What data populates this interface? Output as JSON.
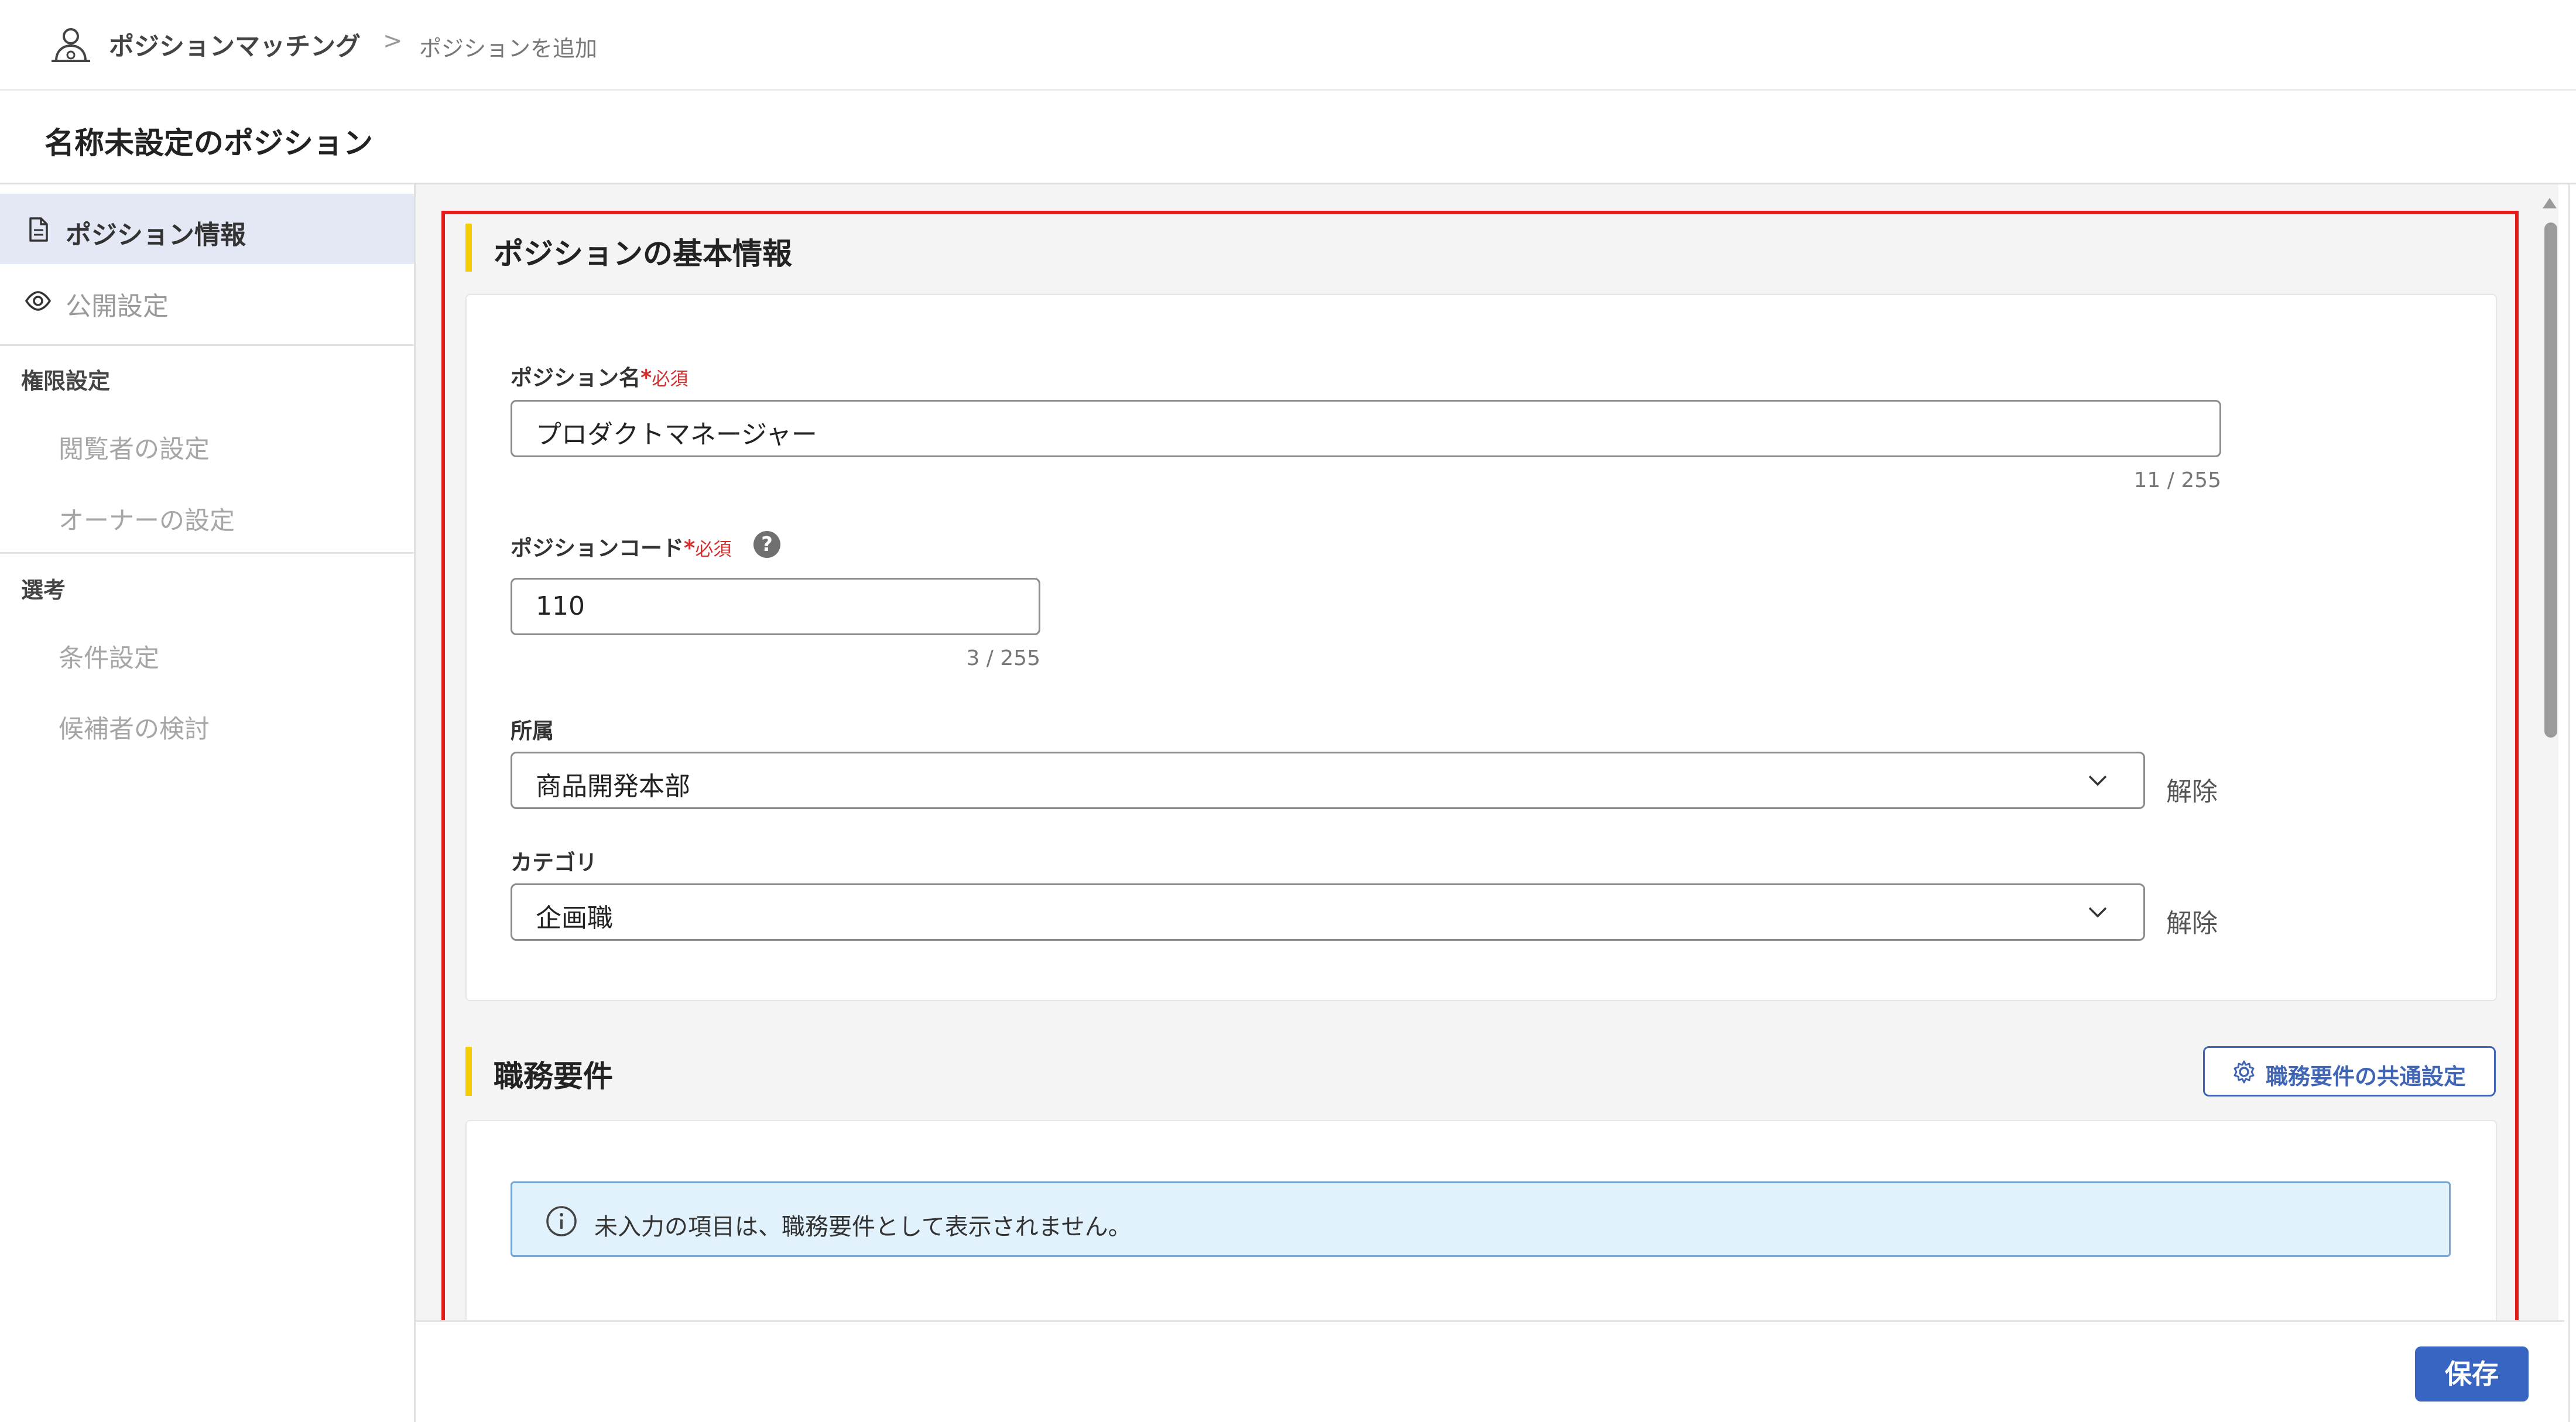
{
  "breadcrumb": {
    "root_label": "ポジションマッチング",
    "separator": ">",
    "current_label": "ポジションを追加"
  },
  "page": {
    "title": "名称未設定のポジション"
  },
  "sidebar": {
    "items": [
      {
        "label": "ポジション情報",
        "icon": "document-icon",
        "active": true
      },
      {
        "label": "公開設定",
        "icon": "eye-icon",
        "active": false
      }
    ],
    "sections": [
      {
        "heading": "権限設定",
        "items": [
          "閲覧者の設定",
          "オーナーの設定"
        ]
      },
      {
        "heading": "選考",
        "items": [
          "条件設定",
          "候補者の検討"
        ]
      }
    ]
  },
  "basic_info": {
    "title": "ポジションの基本情報",
    "position_name": {
      "label": "ポジション名",
      "required_mark": "*",
      "required_text": "必須",
      "value": "プロダクトマネージャー",
      "counter": "11 / 255"
    },
    "position_code": {
      "label": "ポジションコード",
      "required_mark": "*",
      "required_text": "必須",
      "help": "?",
      "value": "110",
      "counter": "3 / 255"
    },
    "department": {
      "label": "所属",
      "value": "商品開発本部",
      "clear_label": "解除"
    },
    "category": {
      "label": "カテゴリ",
      "value": "企画職",
      "clear_label": "解除"
    }
  },
  "job_requirements": {
    "title": "職務要件",
    "common_settings_button": "職務要件の共通設定",
    "info_message": "未入力の項目は、職務要件として表示されません。"
  },
  "footer": {
    "save_label": "保存"
  },
  "colors": {
    "accent_blue": "#3865c2",
    "section_bar_yellow": "#f5cd00",
    "highlight_red": "#e21b1b",
    "info_bg": "#e2f2fc",
    "required_red": "#d32f2f"
  }
}
